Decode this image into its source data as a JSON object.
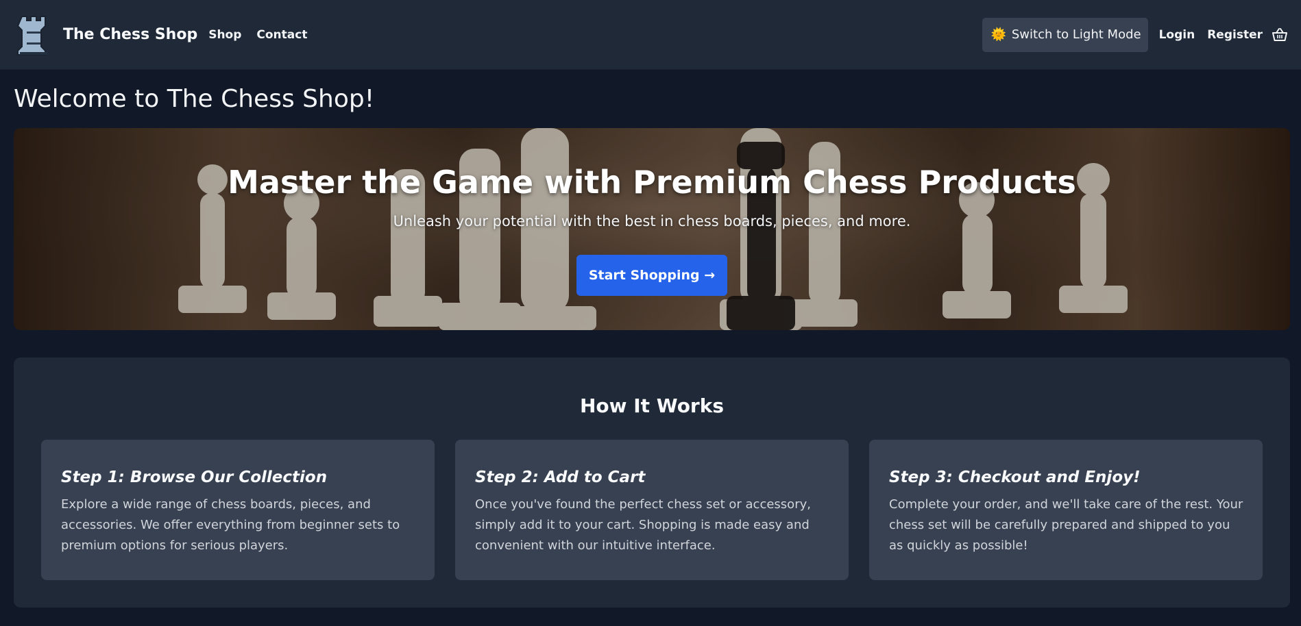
{
  "navbar": {
    "brand": "The Chess Shop",
    "links": [
      "Shop",
      "Contact"
    ],
    "theme_toggle": "Switch to Light Mode",
    "login": "Login",
    "register": "Register",
    "logo_icon": "rook-icon",
    "cart_icon": "basket-icon"
  },
  "page": {
    "welcome": "Welcome to The Chess Shop!"
  },
  "hero": {
    "title": "Master the Game with Premium Chess Products",
    "subtitle": "Unleash your potential with the best in chess boards, pieces, and more.",
    "cta": "Start Shopping →"
  },
  "how_it_works": {
    "title": "How It Works",
    "steps": [
      {
        "title": "Step 1: Browse Our Collection",
        "text": "Explore a wide range of chess boards, pieces, and accessories. We offer everything from beginner sets to premium options for serious players."
      },
      {
        "title": "Step 2: Add to Cart",
        "text": "Once you've found the perfect chess set or accessory, simply add it to your cart. Shopping is made easy and convenient with our intuitive interface."
      },
      {
        "title": "Step 3: Checkout and Enjoy!",
        "text": "Complete your order, and we'll take care of the rest. Your chess set will be carefully prepared and shipped to you as quickly as possible!"
      }
    ]
  },
  "colors": {
    "background": "#111827",
    "surface": "#1f2937",
    "card": "#374151",
    "accent": "#2563eb"
  }
}
